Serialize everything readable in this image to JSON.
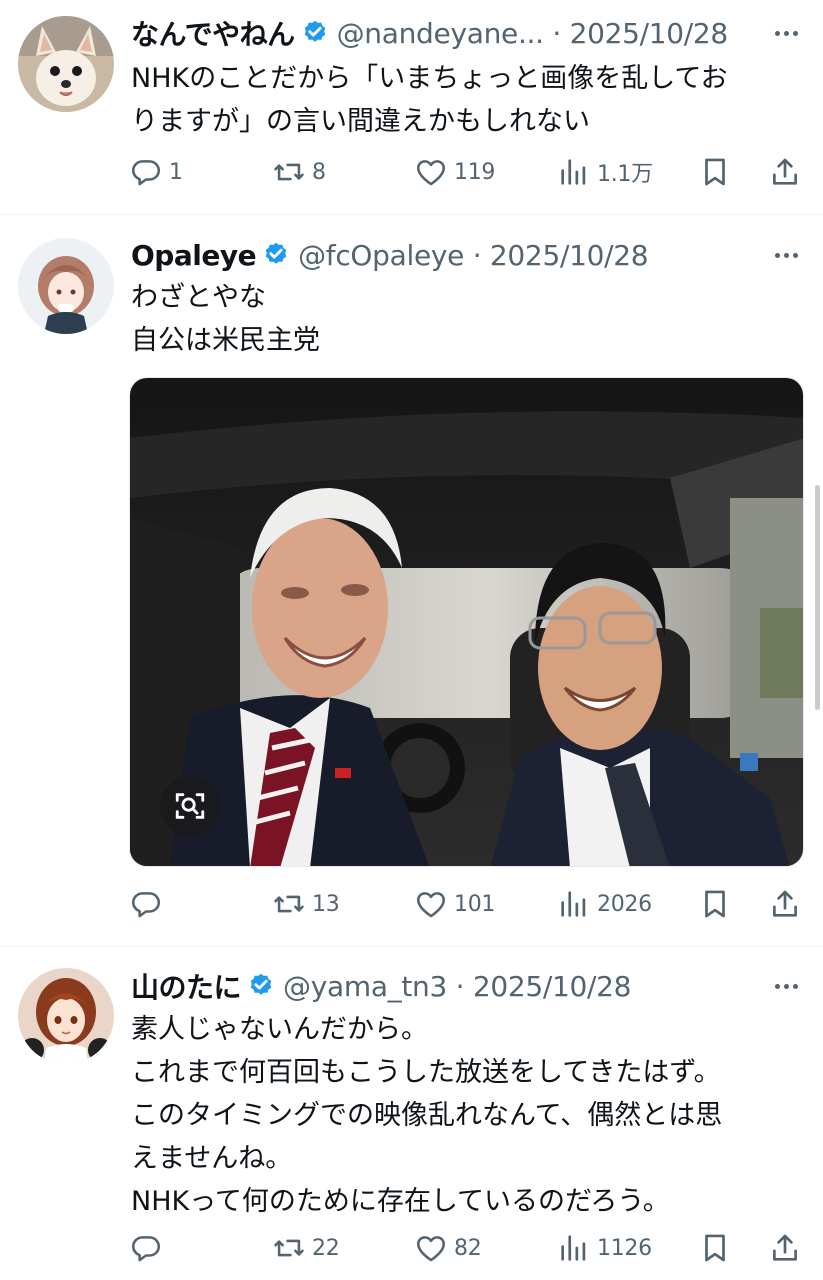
{
  "colors": {
    "text": "#0f1419",
    "secondary": "#536471",
    "verified": "#1d9bf0",
    "divider": "#eff3f4"
  },
  "tweets": [
    {
      "name": "なんでやねん",
      "meta": "@nandeyane... · 2025/10/28",
      "lines": [
        "NHKのことだから「いまちょっと画像を乱してお",
        "りますが」の言い間違えかもしれない"
      ],
      "replies": "1",
      "reposts": "8",
      "likes": "119",
      "views": "1.1万"
    },
    {
      "name": "Opaleye",
      "meta": "@fcOpaleye · 2025/10/28",
      "lines": [
        "わざとやな",
        "自公は米民主党"
      ],
      "replies": "",
      "reposts": "13",
      "likes": "101",
      "views": "2026"
    },
    {
      "name": "山のたに",
      "meta": "@yama_tn3 · 2025/10/28",
      "lines": [
        "素人じゃないんだから。",
        "これまで何百回もこうした放送をしてきたはず。",
        "このタイミングでの映像乱れなんて、偶然とは思",
        "えませんね。",
        "NHKって何のために存在しているのだろう。"
      ],
      "replies": "",
      "reposts": "22",
      "likes": "82",
      "views": "1126"
    }
  ],
  "icons": [
    "reply-icon",
    "repost-icon",
    "like-icon",
    "views-icon",
    "bookmark-icon",
    "share-icon",
    "verified-icon",
    "more-icon",
    "visual-search-icon"
  ]
}
